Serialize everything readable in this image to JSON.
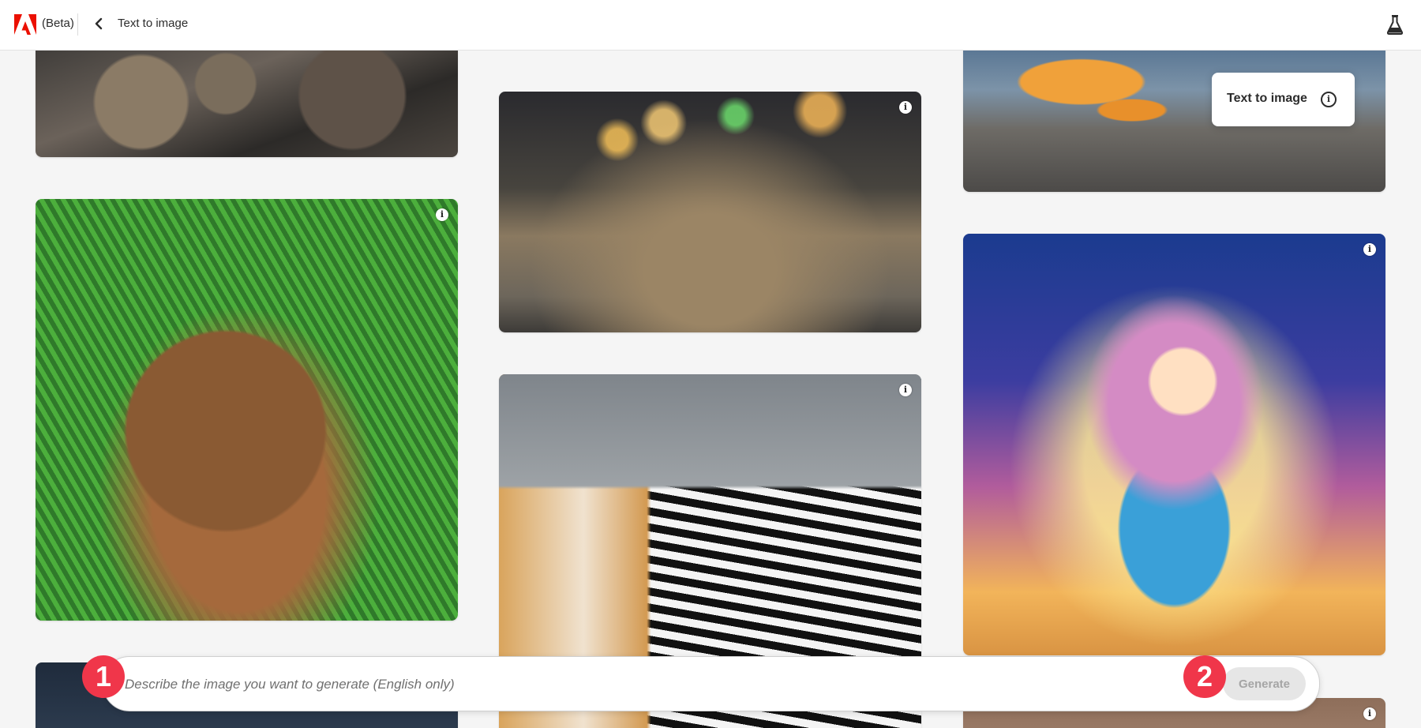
{
  "header": {
    "beta_label": "(Beta)",
    "page_title": "Text to image"
  },
  "tooltip": {
    "label": "Text to image",
    "info_glyph": "i"
  },
  "gallery": {
    "info_glyph": "i",
    "images": [
      {
        "name": "engine-image",
        "desc": "car engine"
      },
      {
        "name": "frog-image",
        "desc": "frog on street"
      },
      {
        "name": "butterfly-image",
        "desc": "butterfly on pavement"
      },
      {
        "name": "dog-image",
        "desc": "terrier in ferns"
      },
      {
        "name": "zebra-image",
        "desc": "zebra with golden chair"
      },
      {
        "name": "girl-image",
        "desc": "girl with stars"
      }
    ]
  },
  "prompt": {
    "placeholder": "Describe the image you want to generate (English only)",
    "value": "",
    "generate_label": "Generate"
  },
  "badges": {
    "one": "1",
    "two": "2"
  },
  "colors": {
    "adobe_red": "#eb1000",
    "badge_red": "#f0364a",
    "background": "#f5f5f5"
  },
  "icons": {
    "logo": "adobe-logo-icon",
    "back": "chevron-left-icon",
    "labs": "beaker-icon",
    "info": "info-icon"
  }
}
